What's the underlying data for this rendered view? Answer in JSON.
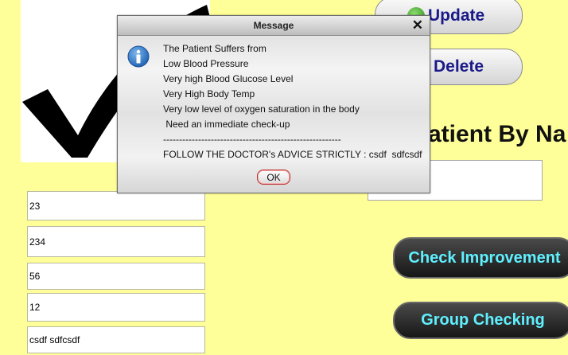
{
  "buttons": {
    "update_label": "Update",
    "delete_label": "Delete",
    "check_improvement_label": "Check Improvement",
    "group_checking_label": "Group Checking"
  },
  "search": {
    "heading": "atient By Na",
    "value": ""
  },
  "fields": [
    {
      "value": "23"
    },
    {
      "value": "234"
    },
    {
      "value": "56"
    },
    {
      "value": "12"
    },
    {
      "value": "csdf  sdfcsdf"
    }
  ],
  "dialog": {
    "title": "Message",
    "close_symbol": "✕",
    "lines": [
      "The Patient Suffers from",
      "Low Blood Pressure",
      "Very high Blood Glucose Level",
      "Very High Body Temp",
      "Very low level of oxygen saturation in the body",
      " Need an immediate check-up",
      "--------------------------------------------------------",
      "FOLLOW THE DOCTOR's ADVICE STRICTLY : csdf  sdfcsdf"
    ],
    "ok_label": "OK"
  },
  "colors": {
    "background": "#ffff99",
    "dark_button_text": "#5ff0ff",
    "light_button_text": "#1a1a8a"
  },
  "icons": {
    "checkmark": "checkmark-icon",
    "info": "info-icon",
    "update": "refresh-icon"
  }
}
